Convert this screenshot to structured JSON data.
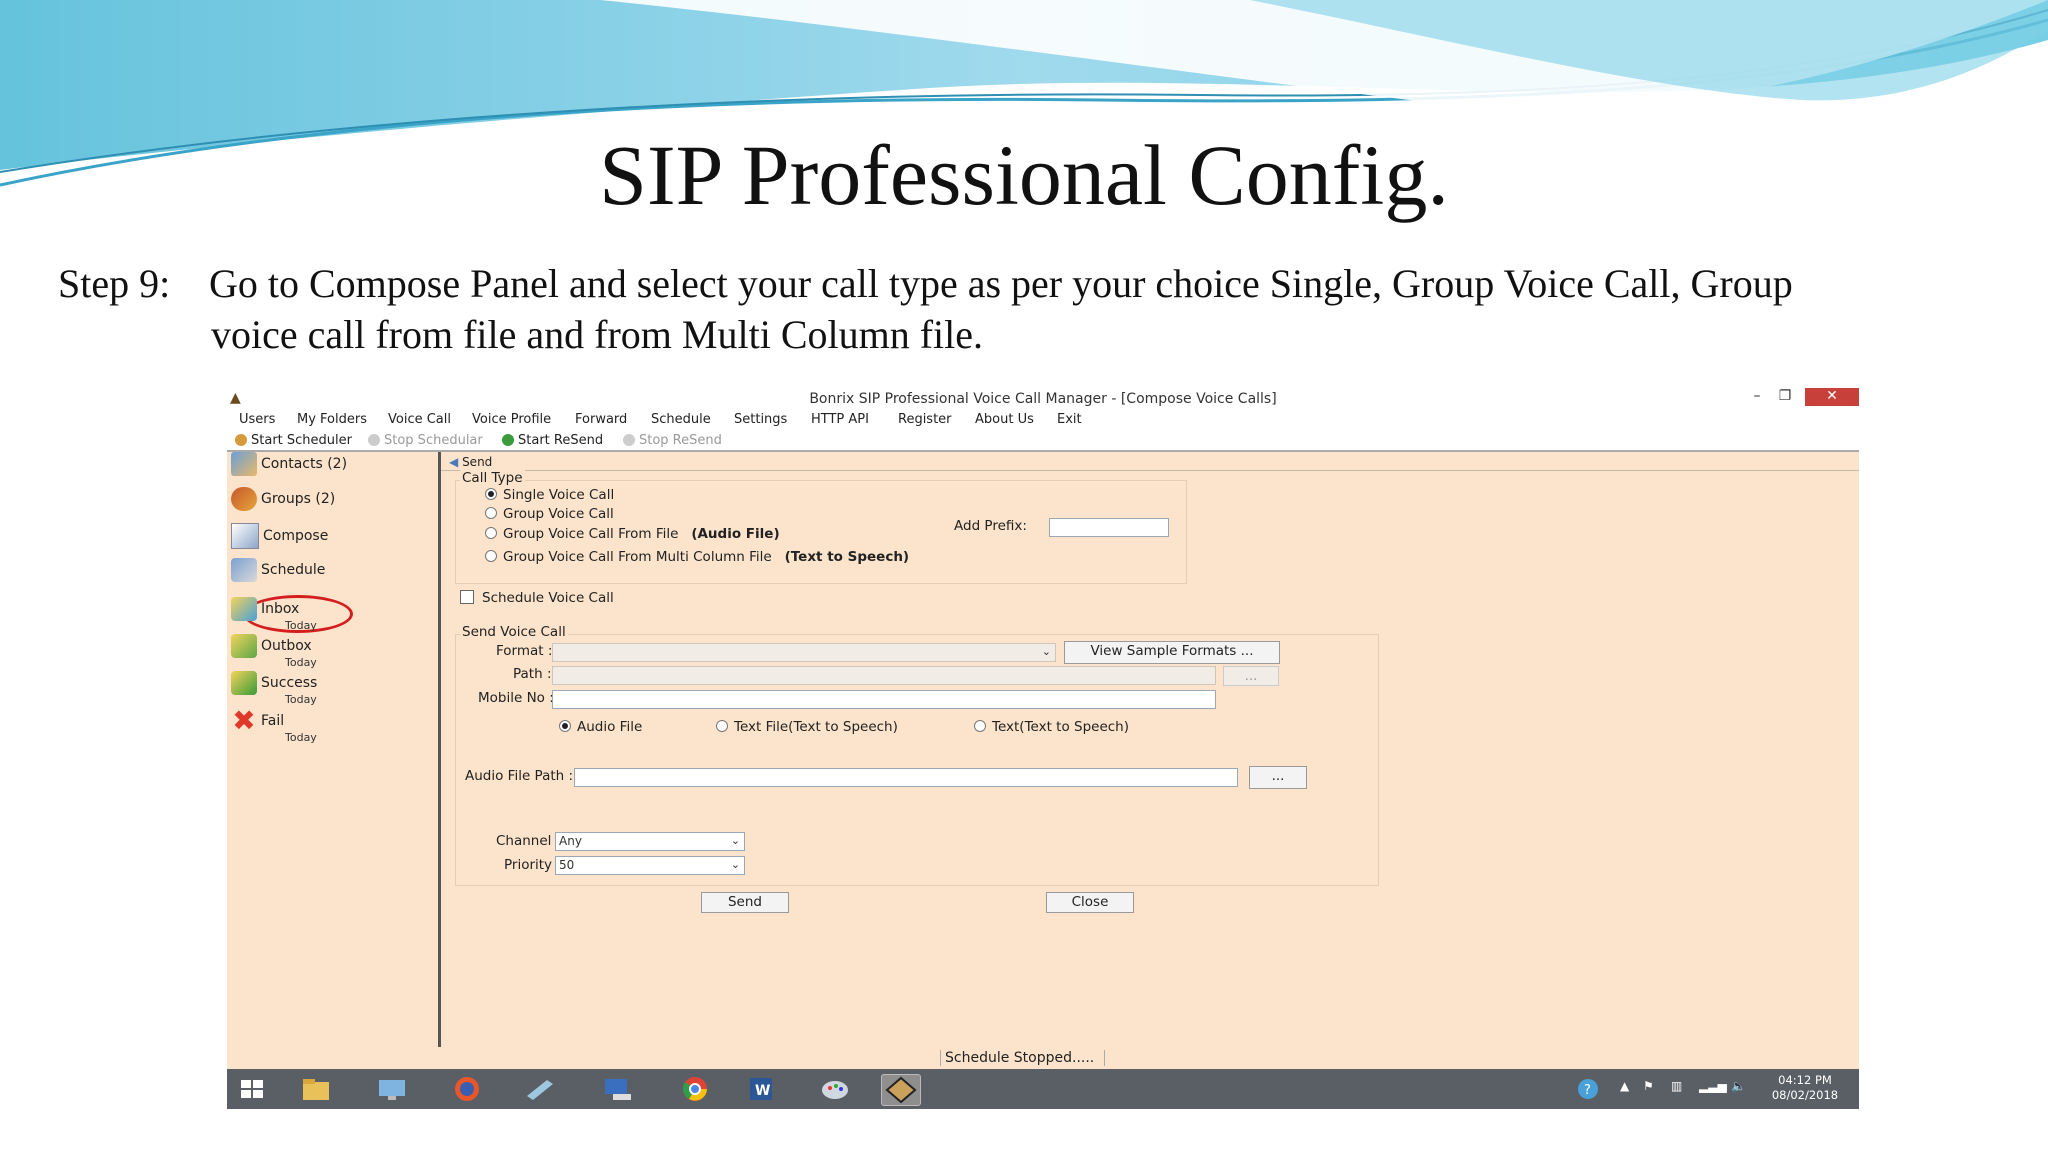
{
  "slide": {
    "title": "SIP  Professional Config.",
    "step_number": "Step 9:",
    "step_line1": "Go to Compose Panel and select your call type as per your choice Single, Group Voice Call, Group",
    "step_line2": "voice call from file and from Multi Column file."
  },
  "window": {
    "title": "Bonrix SIP Professional Voice Call Manager - [Compose Voice Calls]",
    "minimize": "–",
    "restore": "❐",
    "close": "✕"
  },
  "menu": [
    "Users",
    "My Folders",
    "Voice Call",
    "Voice Profile",
    "Forward",
    "Schedule",
    "Settings",
    "HTTP API",
    "Register",
    "About Us",
    "Exit"
  ],
  "toolbar": {
    "start_scheduler": "Start Scheduler",
    "stop_scheduler": "Stop Schedular",
    "start_resend": "Start ReSend",
    "stop_resend": "Stop ReSend"
  },
  "sidebar": {
    "contacts": "Contacts (2)",
    "groups": "Groups (2)",
    "compose": "Compose",
    "schedule": "Schedule",
    "inbox": "Inbox",
    "inbox_sub": "Today",
    "outbox": "Outbox",
    "outbox_sub": "Today",
    "success": "Success",
    "success_sub": "Today",
    "fail": "Fail",
    "fail_sub": "Today"
  },
  "compose": {
    "tab": "Send",
    "call_type_label": "Call Type",
    "options": {
      "single": "Single Voice Call",
      "group": "Group Voice Call",
      "group_file": "Group Voice Call From File",
      "group_file_note": "(Audio File)",
      "group_multi": "Group Voice Call From Multi Column File",
      "group_multi_note": "(Text to Speech)"
    },
    "selected_option": "Single Voice Call",
    "add_prefix_label": "Add Prefix:",
    "add_prefix_value": "",
    "schedule_checkbox": "Schedule Voice Call",
    "schedule_checked": false,
    "send_group_label": "Send Voice Call",
    "format_label": "Format :",
    "format_value": "",
    "view_formats_button": "View Sample Formats ...",
    "path_label": "Path :",
    "path_value": "",
    "path_browse": "...",
    "mobile_label": "Mobile No :",
    "mobile_value": "",
    "mode_audio": "Audio File",
    "mode_textfile": "Text File(Text to Speech)",
    "mode_text": "Text(Text to Speech)",
    "selected_mode": "Audio File",
    "audio_path_label": "Audio File Path :",
    "audio_path_value": "",
    "audio_browse": "...",
    "channel_label": "Channel :",
    "channel_value": "Any",
    "priority_label": "Priority :",
    "priority_value": "50",
    "send_button": "Send",
    "close_button": "Close"
  },
  "status": {
    "text": "Schedule Stopped....."
  },
  "tray": {
    "time": "04:12 PM",
    "date": "08/02/2018"
  },
  "colors": {
    "panel_bg": "#fbe4cb",
    "close_button": "#c7403a",
    "taskbar": "#5a5f66",
    "compose_highlight": "#d41e1e"
  }
}
